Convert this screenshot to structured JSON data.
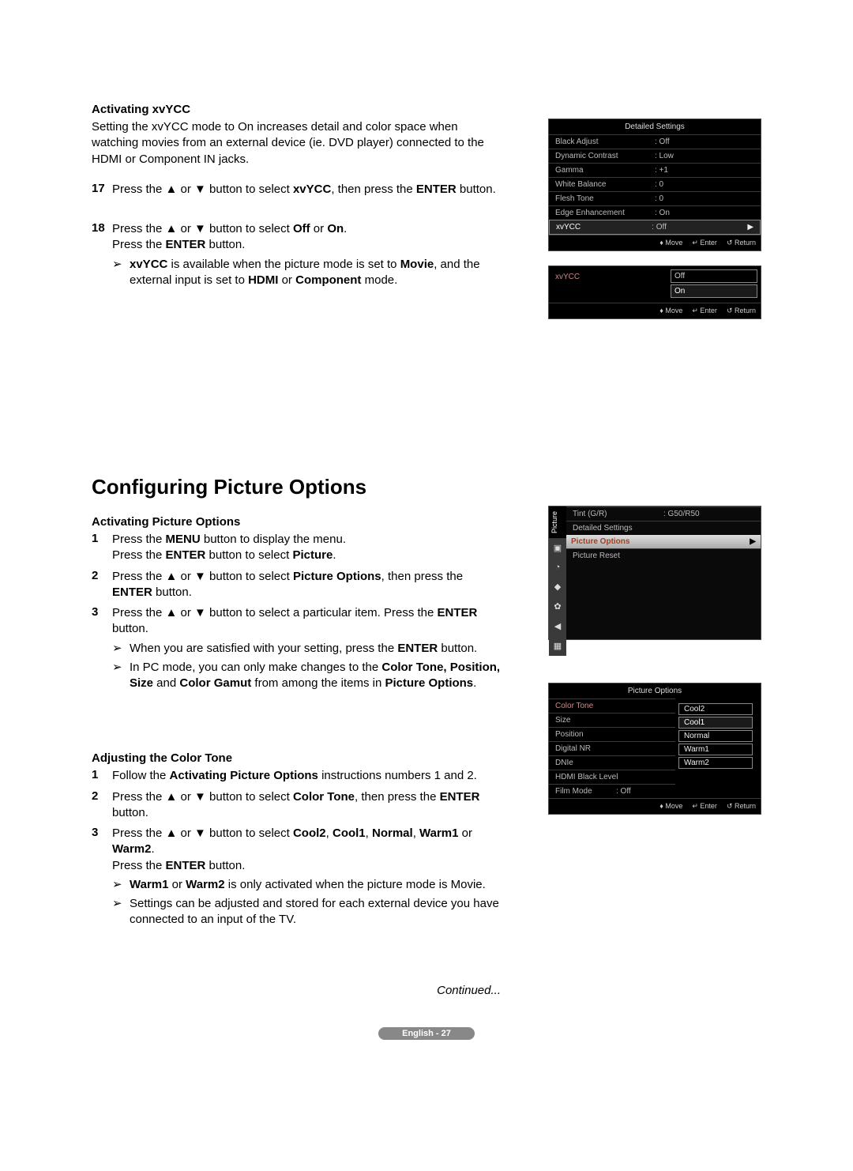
{
  "section1": {
    "title": "Activating xvYCC",
    "intro": "Setting the xvYCC mode to On increases detail and color space when watching movies from an external device (ie. DVD player) connected to the HDMI or Component IN jacks.",
    "step17_num": "17",
    "step17_a": "Press the ▲ or ▼ button to select ",
    "step17_b": "xvYCC",
    "step17_c": ", then press the ",
    "step17_d": "ENTER",
    "step17_e": " button.",
    "step18_num": "18",
    "step18_l1a": "Press the ▲ or ▼ button to select ",
    "step18_l1b": "Off",
    "step18_l1c": " or ",
    "step18_l1d": "On",
    "step18_l1e": ".",
    "step18_l2a": "Press the ",
    "step18_l2b": "ENTER",
    "step18_l2c": " button.",
    "step18_sub_a": "xvYCC",
    "step18_sub_b": " is available when the picture mode is set to ",
    "step18_sub_c": "Movie",
    "step18_sub_d": ", and the external input is set to ",
    "step18_sub_e": "HDMI",
    "step18_sub_f": " or ",
    "step18_sub_g": "Component",
    "step18_sub_h": " mode."
  },
  "osd1": {
    "title": "Detailed Settings",
    "rows": [
      {
        "label": "Black Adjust",
        "val": ": Off"
      },
      {
        "label": "Dynamic Contrast",
        "val": ": Low"
      },
      {
        "label": "Gamma",
        "val": ": +1"
      },
      {
        "label": "White Balance",
        "val": ": 0"
      },
      {
        "label": "Flesh Tone",
        "val": ": 0"
      },
      {
        "label": "Edge Enhancement",
        "val": ": On"
      },
      {
        "label": "xvYCC",
        "val": ": Off"
      }
    ],
    "foot_move": "Move",
    "foot_enter": "Enter",
    "foot_return": "Return"
  },
  "osd2": {
    "label": "xvYCC",
    "opt1": "Off",
    "opt2": "On",
    "foot_move": "Move",
    "foot_enter": "Enter",
    "foot_return": "Return"
  },
  "heading2": "Configuring Picture Options",
  "section2": {
    "title": "Activating Picture Options",
    "s1_num": "1",
    "s1_a": "Press the ",
    "s1_b": "MENU",
    "s1_c": " button to display the menu.",
    "s1_l2a": "Press the ",
    "s1_l2b": "ENTER",
    "s1_l2c": " button to select ",
    "s1_l2d": "Picture",
    "s1_l2e": ".",
    "s2_num": "2",
    "s2_a": "Press the ▲ or ▼ button to select ",
    "s2_b": "Picture Options",
    "s2_c": ", then press the ",
    "s2_d": "ENTER",
    "s2_e": " button.",
    "s3_num": "3",
    "s3_a": "Press the ▲ or ▼ button to select a particular item. Press the ",
    "s3_b": "ENTER",
    "s3_c": " button.",
    "s3_sub1_a": "When you are satisfied with your setting, press the ",
    "s3_sub1_b": "ENTER",
    "s3_sub1_c": " button.",
    "s3_sub2_a": "In PC mode, you can only make changes to the ",
    "s3_sub2_b": "Color Tone, Position, Size",
    "s3_sub2_c": " and ",
    "s3_sub2_d": "Color Gamut",
    "s3_sub2_e": " from among the items in ",
    "s3_sub2_f": "Picture Options",
    "s3_sub2_g": "."
  },
  "osd3": {
    "side_label": "Picture",
    "r1_label": "Tint (G/R)",
    "r1_val": ": G50/R50",
    "r2": "Detailed Settings",
    "r3": "Picture Options",
    "r4": "Picture Reset"
  },
  "section3": {
    "title": "Adjusting the Color Tone",
    "s1_num": "1",
    "s1_a": "Follow the ",
    "s1_b": "Activating Picture Options",
    "s1_c": " instructions numbers 1 and 2.",
    "s2_num": "2",
    "s2_a": "Press the ▲ or ▼ button to select ",
    "s2_b": "Color Tone",
    "s2_c": ", then press the ",
    "s2_d": "ENTER",
    "s2_e": " button.",
    "s3_num": "3",
    "s3_a": "Press the ▲ or ▼ button to select ",
    "s3_b": "Cool2",
    "s3_c": ", ",
    "s3_d": "Cool1",
    "s3_e": ", ",
    "s3_f": "Normal",
    "s3_g": ", ",
    "s3_h": "Warm1",
    "s3_i": " or ",
    "s3_j": "Warm2",
    "s3_k": ".",
    "s3_l2a": "Press the ",
    "s3_l2b": "ENTER",
    "s3_l2c": " button.",
    "s3_sub1_a": "Warm1",
    "s3_sub1_b": " or ",
    "s3_sub1_c": "Warm2",
    "s3_sub1_d": " is only activated when the picture mode is Movie.",
    "s3_sub2": "Settings can be adjusted and stored for each external device you have connected to an input of the TV."
  },
  "osd4": {
    "title": "Picture Options",
    "labels": [
      "Color Tone",
      "Size",
      "Position",
      "Digital NR",
      "DNIe",
      "HDMI Black Level",
      "Film Mode"
    ],
    "filmval": ": Off",
    "opts": [
      "Cool2",
      "Cool1",
      "Normal",
      "Warm1",
      "Warm2"
    ],
    "foot_move": "Move",
    "foot_enter": "Enter",
    "foot_return": "Return"
  },
  "continued": "Continued...",
  "pagefoot": "English - 27"
}
